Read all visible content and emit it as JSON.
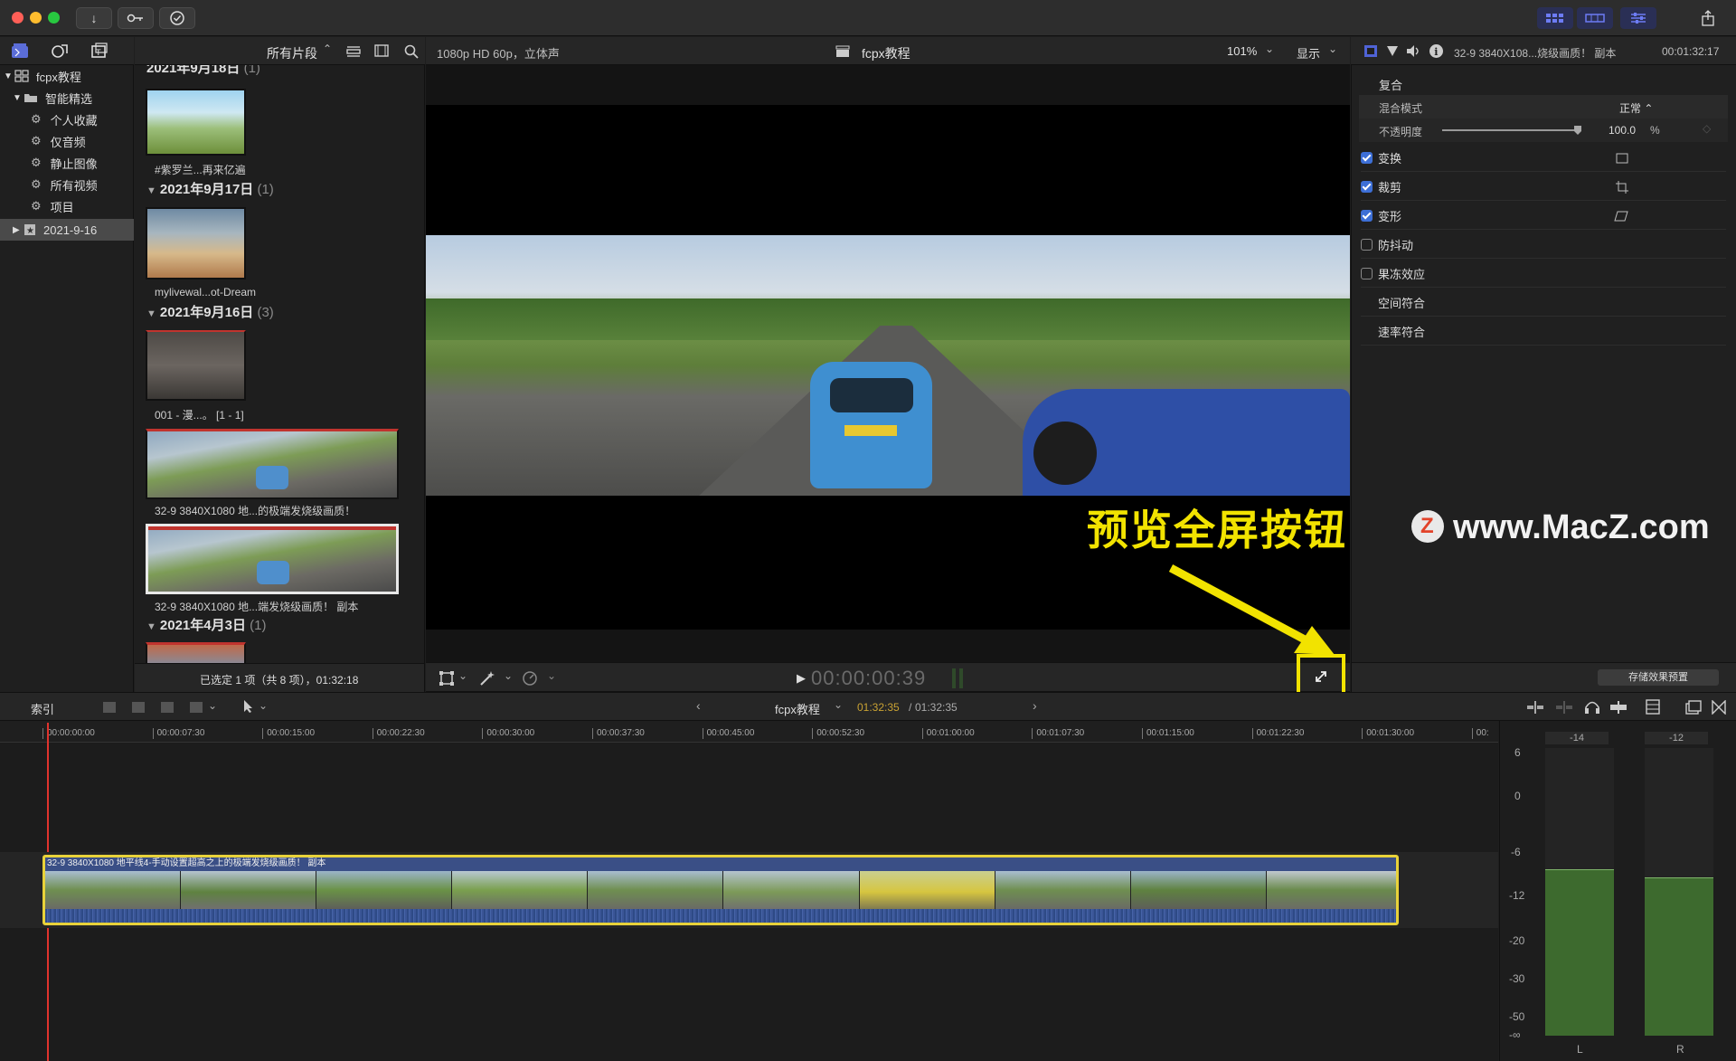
{
  "toolbar": {
    "import_icon": "↓",
    "keyword_icon": "key-icon",
    "check_icon": "✓"
  },
  "browser_bar": {
    "filter_label": "所有片段",
    "search_icon": "search-icon"
  },
  "viewer_bar": {
    "format": "1080p HD 60p，立体声",
    "project": "fcpx教程",
    "zoom": "101%",
    "display": "显示"
  },
  "inspector_bar": {
    "clip_name": "32-9 3840X108...烧级画质！ 副本",
    "timecode": "00:01:32:17"
  },
  "library": {
    "root": "fcpx教程",
    "smart_folder": "智能精选",
    "items": [
      "个人收藏",
      "仅音频",
      "静止图像",
      "所有视频",
      "项目"
    ],
    "event": "2021-9-16"
  },
  "browser": {
    "date_top": "2021年9月18日",
    "date_top_count": "(1)",
    "clip1_caption": "#紫罗兰...再来亿遍",
    "date2": "2021年9月17日",
    "date2_count": "(1)",
    "clip2_caption": "mylivewal...ot-Dream",
    "date3": "2021年9月16日",
    "date3_count": "(3)",
    "clip3_caption": "001 - 漫...。 [1 - 1]",
    "clip4_caption": "32-9 3840X1080 地...的极端发烧级画质！",
    "clip5_caption": "32-9 3840X1080 地...端发烧级画质！ 副本",
    "date4": "2021年4月3日",
    "date4_count": "(1)",
    "status": "已选定 1 项（共 8 项），01:32:18"
  },
  "inspector": {
    "section": "复合",
    "blend_label": "混合模式",
    "blend_value": "正常 ⌃",
    "opacity_label": "不透明度",
    "opacity_value": "100.0",
    "opacity_unit": "%",
    "opacity_level": 1.0,
    "effects": [
      {
        "label": "变换",
        "checked": true
      },
      {
        "label": "裁剪",
        "checked": true
      },
      {
        "label": "变形",
        "checked": true
      },
      {
        "label": "防抖动",
        "checked": false
      },
      {
        "label": "果冻效应",
        "checked": false
      },
      {
        "label": "空间符合",
        "checked": null
      },
      {
        "label": "速率符合",
        "checked": null
      }
    ],
    "save_preset": "存储效果预置"
  },
  "playback": {
    "play_icon": "▶",
    "timecode": "00:00:00:39",
    "fullscreen_icon": "expand-icon"
  },
  "annotation": {
    "text": "预览全屏按钮",
    "watermark": "www.MacZ.com",
    "watermark_logo": "Z"
  },
  "timeline_bar": {
    "index_label": "索引",
    "project": "fcpx教程",
    "current_time": "01:32:35",
    "total_time": "01:32:35"
  },
  "ruler_ticks": [
    "00:00:00:00",
    "00:00:07:30",
    "00:00:15:00",
    "00:00:22:30",
    "00:00:30:00",
    "00:00:37:30",
    "00:00:45:00",
    "00:00:52:30",
    "00:01:00:00",
    "00:01:07:30",
    "00:01:15:00",
    "00:01:22:30",
    "00:01:30:00",
    "00:"
  ],
  "clip": {
    "title": "32-9 3840X1080 地平线4-手动设置超高之上的极端发烧级画质！ 副本"
  },
  "meters": {
    "top_left": "-14",
    "top_right": "-12",
    "scale": [
      "6",
      "0",
      "-6",
      "-12",
      "-20",
      "-30",
      "-50",
      "-∞"
    ],
    "left_label": "L",
    "right_label": "R",
    "left_level": 0.58,
    "right_level": 0.55
  },
  "colors": {
    "accent_blue": "#3d6fd6",
    "highlight_yellow": "#f2e300",
    "meter_green": "#3d6a2e",
    "playhead_red": "#e0332d"
  }
}
